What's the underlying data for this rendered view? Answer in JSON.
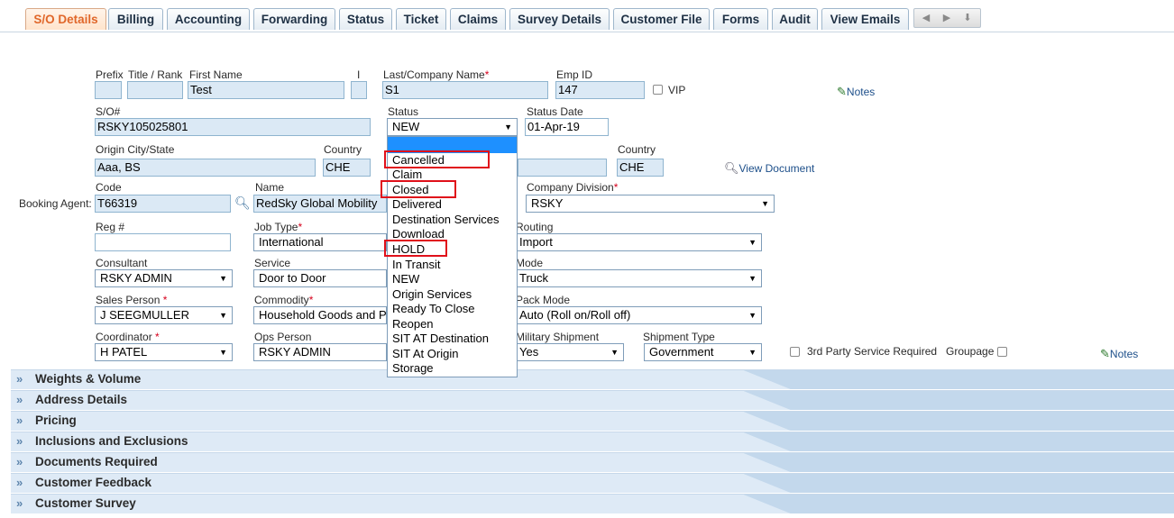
{
  "tabs": [
    "S/O Details",
    "Billing",
    "Accounting",
    "Forwarding",
    "Status",
    "Ticket",
    "Claims",
    "Survey Details",
    "Customer File",
    "Forms",
    "Audit",
    "View Emails"
  ],
  "form": {
    "prefix_label": "Prefix",
    "title_label": "Title / Rank",
    "first_name_label": "First Name",
    "first_name_value": "Test",
    "mi_label": "I",
    "last_name_label": "Last/Company Name",
    "last_name_value": "S1",
    "emp_id_label": "Emp ID",
    "emp_id_value": "147",
    "vip_label": "VIP",
    "notes_label": "Notes",
    "so_label": "S/O#",
    "so_value": "RSKY105025801",
    "status_label": "Status",
    "status_value": "NEW",
    "status_date_label": "Status Date",
    "status_date_value": "01-Apr-19",
    "origin_label": "Origin City/State",
    "origin_value": "Aaa, BS",
    "country_label": "Country",
    "origin_country_value": "CHE",
    "dest_country_label": "Country",
    "dest_country_value": "CHE",
    "view_document_label": "View Document",
    "booking_agent_label": "Booking Agent:",
    "code_label": "Code",
    "code_value": "T66319",
    "name_label": "Name",
    "name_value": "RedSky Global Mobility",
    "company_division_label": "Company Division",
    "company_division_value": "RSKY",
    "reg_label": "Reg #",
    "job_type_label": "Job Type",
    "job_type_value": "International",
    "routing_label": "Routing",
    "routing_value": "Import",
    "consultant_label": "Consultant",
    "consultant_value": "RSKY ADMIN",
    "service_label": "Service",
    "service_value": "Door to Door",
    "mode_label": "Mode",
    "mode_value": "Truck",
    "sales_person_label": "Sales Person",
    "sales_person_value": "J SEEGMULLER",
    "commodity_label": "Commodity",
    "commodity_value": "Household Goods and P",
    "pack_mode_label": "Pack Mode",
    "pack_mode_value": "Auto (Roll on/Roll off)",
    "coordinator_label": "Coordinator",
    "coordinator_value": "H PATEL",
    "ops_person_label": "Ops Person",
    "ops_person_value": "RSKY ADMIN",
    "military_label": "Military Shipment",
    "military_value": "Yes",
    "shipment_type_label": "Shipment Type",
    "shipment_type_value": "Government",
    "third_party_label": "3rd Party Service Required",
    "groupage_label": "Groupage",
    "notes2_label": "Notes"
  },
  "status_options": [
    "Cancelled",
    "Claim",
    "Closed",
    "Delivered",
    "Destination Services",
    "Download",
    "HOLD",
    "In Transit",
    "NEW",
    "Origin Services",
    "Ready To Close",
    "Reopen",
    "SIT AT Destination",
    "SIT At Origin",
    "Storage"
  ],
  "sections": [
    "Weights & Volume",
    "Address Details",
    "Pricing",
    "Inclusions and Exclusions",
    "Documents Required",
    "Customer Feedback",
    "Customer Survey"
  ],
  "colors": {
    "active_tab": "#e0672a",
    "highlight": "#e0101a",
    "selected_option": "#1e90ff"
  }
}
